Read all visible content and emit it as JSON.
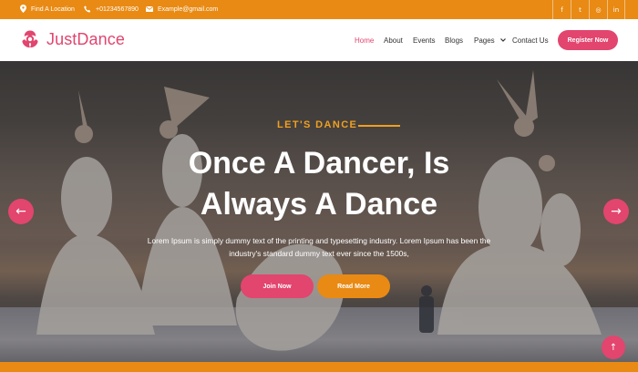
{
  "topbar": {
    "location": "Find A Location",
    "phone": "+01234567890",
    "email": "Example@gmail.com",
    "socials": [
      {
        "icon": "facebook-icon",
        "glyph": "f"
      },
      {
        "icon": "twitter-icon",
        "glyph": "t"
      },
      {
        "icon": "instagram-icon",
        "glyph": "◎"
      },
      {
        "icon": "linkedin-icon",
        "glyph": "in"
      }
    ]
  },
  "navbar": {
    "brand": "JustDance",
    "menu": {
      "home": "Home",
      "about": "About",
      "events": "Events",
      "blogs": "Blogs",
      "pages": "Pages",
      "contact": "Contact Us"
    },
    "register": "Register Now"
  },
  "hero": {
    "kicker": "LET'S DANCE",
    "headline_line1": "Once A Dancer, Is",
    "headline_line2": "Always A Dance",
    "sub_line1": "Lorem Ipsum is simply dummy text of the printing and typesetting industry. Lorem Ipsum has been the",
    "sub_line2": "industry's standard dummy text ever since the 1500s,",
    "join_button": "Join Now",
    "read_button": "Read More",
    "prev_arrow": "←",
    "next_arrow": "→"
  },
  "back_to_top": "↑",
  "colors": {
    "orange": "#e88a14",
    "pink": "#e2456e",
    "kicker": "#f0a020"
  }
}
